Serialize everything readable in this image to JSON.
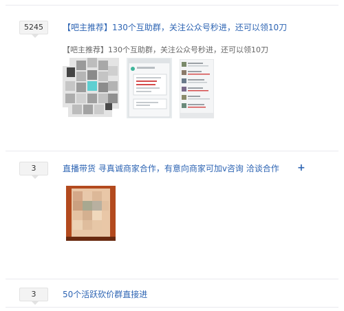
{
  "threads": [
    {
      "reply_count": "5245",
      "title": "【吧主推荐】130个互助群，关注公众号秒进，还可以领10刀",
      "abstract": "【吧主推荐】130个互助群，关注公众号秒进，还可以领10刀"
    },
    {
      "reply_count": "3",
      "title": "直播带货 寻真诚商家合作，有意向商家可加v咨询 洽谈合作",
      "action_icon": "plus-icon"
    },
    {
      "reply_count": "3",
      "title": "50个活跃砍价群直接进"
    }
  ]
}
